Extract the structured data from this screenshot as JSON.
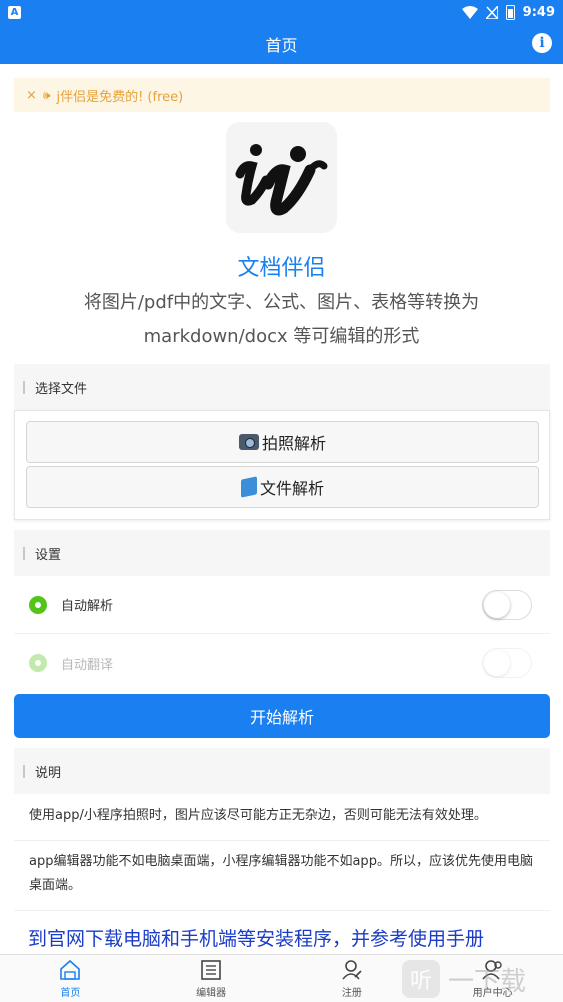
{
  "status_bar": {
    "indicator": "A",
    "time": "9:49"
  },
  "header": {
    "title": "首页"
  },
  "notice": {
    "close": "×",
    "speaker": "🕪",
    "text": "j伴侣是免费的! (free)"
  },
  "app": {
    "name": "文档伴侣",
    "description": "将图片/pdf中的文字、公式、图片、表格等转换为markdown/docx 等可编辑的形式"
  },
  "file_section": {
    "title": "选择文件",
    "buttons": [
      {
        "label": "拍照解析",
        "icon": "camera-icon"
      },
      {
        "label": "文件解析",
        "icon": "book-icon"
      }
    ]
  },
  "settings_section": {
    "title": "设置",
    "items": [
      {
        "label": "自动解析",
        "enabled": true,
        "on": false
      },
      {
        "label": "自动翻译",
        "enabled": false,
        "on": false
      }
    ]
  },
  "start_button": {
    "label": "开始解析"
  },
  "notes_section": {
    "title": "说明",
    "items": [
      "使用app/小程序拍照时，图片应该尽可能方正无杂边，否则可能无法有效处理。",
      "app编辑器功能不如电脑桌面端，小程序编辑器功能不如app。所以，应该优先使用电脑桌面端。"
    ],
    "link": "到官网下载电脑和手机端等安装程序，并参考使用手册"
  },
  "tabbar": {
    "items": [
      {
        "label": "首页",
        "icon": "home-icon",
        "active": true
      },
      {
        "label": "编辑器",
        "icon": "editor-icon",
        "active": false
      },
      {
        "label": "注册",
        "icon": "register-icon",
        "active": false
      },
      {
        "label": "用户中心",
        "icon": "user-center-icon",
        "active": false
      }
    ]
  },
  "watermark": {
    "glyph": "听",
    "text": "一下载"
  },
  "colors": {
    "primary": "#1a7ff0",
    "notice_bg": "#fdf6e4",
    "notice_text": "#e6a23c",
    "gear": "#52c41a",
    "link": "#1a3cc8"
  }
}
